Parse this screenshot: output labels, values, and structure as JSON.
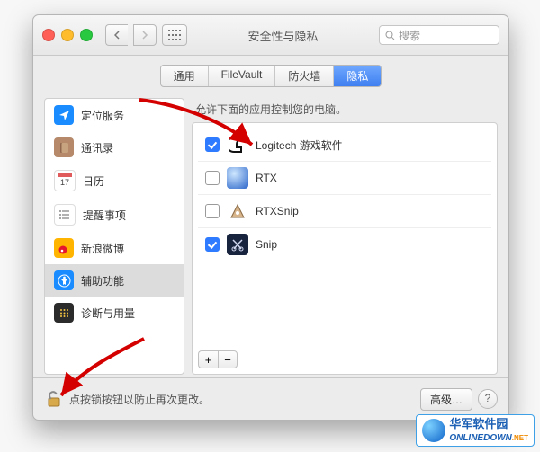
{
  "window": {
    "title": "安全性与隐私",
    "search_placeholder": "搜索"
  },
  "tabs": [
    {
      "id": "general",
      "label": "通用",
      "active": false
    },
    {
      "id": "filevault",
      "label": "FileVault",
      "active": false
    },
    {
      "id": "firewall",
      "label": "防火墙",
      "active": false
    },
    {
      "id": "privacy",
      "label": "隐私",
      "active": true
    }
  ],
  "sidebar": {
    "items": [
      {
        "id": "location",
        "label": "定位服务",
        "icon": "location-arrow",
        "bg": "#1a8cff",
        "selected": false
      },
      {
        "id": "contacts",
        "label": "通讯录",
        "icon": "book",
        "bg": "#b5896a",
        "selected": false
      },
      {
        "id": "calendar",
        "label": "日历",
        "icon": "calendar",
        "bg": "#ffffff",
        "selected": false
      },
      {
        "id": "reminders",
        "label": "提醒事项",
        "icon": "list",
        "bg": "#ffffff",
        "selected": false
      },
      {
        "id": "weibo",
        "label": "新浪微博",
        "icon": "weibo",
        "bg": "#ffb400",
        "selected": false
      },
      {
        "id": "accessibility",
        "label": "辅助功能",
        "icon": "accessibility",
        "bg": "#1a8cff",
        "selected": true
      },
      {
        "id": "diagnostics",
        "label": "诊断与用量",
        "icon": "dots",
        "bg": "#2b2b2b",
        "selected": false
      }
    ]
  },
  "main": {
    "hint": "允许下面的应用控制您的电脑。",
    "apps": [
      {
        "name": "Logitech 游戏软件",
        "checked": true,
        "icon": "logitech"
      },
      {
        "name": "RTX",
        "checked": false,
        "icon": "rtx"
      },
      {
        "name": "RTXSnip",
        "checked": false,
        "icon": "rtxsnip"
      },
      {
        "name": "Snip",
        "checked": true,
        "icon": "snip"
      }
    ],
    "add_label": "+",
    "remove_label": "−"
  },
  "footer": {
    "lock_message": "点按锁按钮以防止再次更改。",
    "advanced_label": "高级…",
    "help_label": "?"
  },
  "watermark": {
    "cn": "华军软件园",
    "en": "ONLINEDOWN",
    "suffix": ".NET"
  }
}
